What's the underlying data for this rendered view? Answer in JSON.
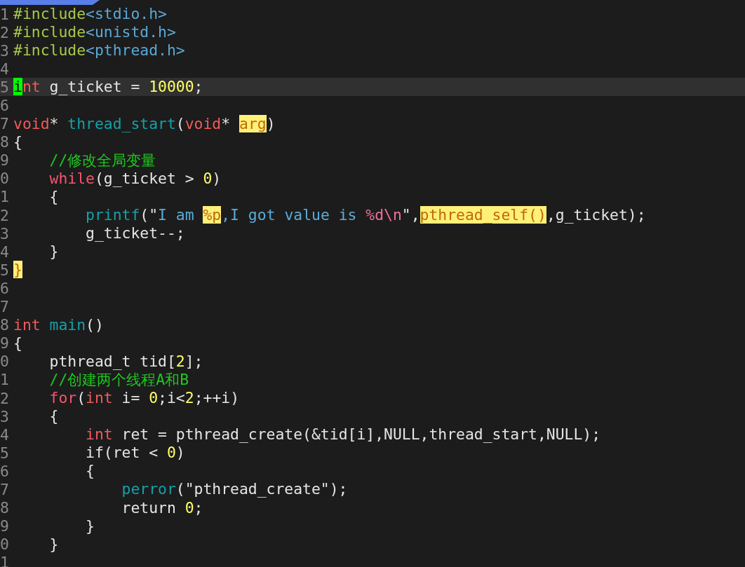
{
  "lines": [
    {
      "number": "1",
      "current": false,
      "tokens": [
        {
          "kind": "preproc",
          "text": "#include"
        },
        {
          "kind": "header",
          "text": "<stdio.h>"
        }
      ]
    },
    {
      "number": "2",
      "current": false,
      "tokens": [
        {
          "kind": "preproc",
          "text": "#include"
        },
        {
          "kind": "header",
          "text": "<unistd.h>"
        }
      ]
    },
    {
      "number": "3",
      "current": false,
      "tokens": [
        {
          "kind": "preproc",
          "text": "#include"
        },
        {
          "kind": "header",
          "text": "<pthread.h>"
        }
      ]
    },
    {
      "number": "4",
      "current": false
    },
    {
      "number": "5",
      "current": true,
      "tokens": [
        {
          "kind": "cursor",
          "text": "i"
        },
        {
          "kind": "keyword",
          "text": "nt"
        },
        {
          "kind": "plain",
          "text": " g_ticket = "
        },
        {
          "kind": "number",
          "text": "10000"
        },
        {
          "kind": "plain",
          "text": ";"
        }
      ]
    },
    {
      "number": "6",
      "current": false
    },
    {
      "number": "7",
      "current": false,
      "tokens": [
        {
          "kind": "keyword",
          "text": "void"
        },
        {
          "kind": "plain",
          "text": "* "
        },
        {
          "kind": "func",
          "text": "thread_start"
        },
        {
          "kind": "plain",
          "text": "("
        },
        {
          "kind": "keyword",
          "text": "void"
        },
        {
          "kind": "plain",
          "text": "* "
        },
        {
          "kind": "match",
          "text": "arg"
        },
        {
          "kind": "plain",
          "text": ")"
        }
      ]
    },
    {
      "number": "8",
      "current": false,
      "tokens": [
        {
          "kind": "plain",
          "text": "{"
        }
      ]
    },
    {
      "number": "9",
      "current": false,
      "tokens": [
        {
          "kind": "comment",
          "text": "    //修改全局变量"
        }
      ]
    },
    {
      "number": "0",
      "current": false,
      "tokens": [
        {
          "kind": "control",
          "text": "    while"
        },
        {
          "kind": "plain",
          "text": "(g_ticket > "
        },
        {
          "kind": "number",
          "text": "0"
        },
        {
          "kind": "plain",
          "text": ")"
        }
      ]
    },
    {
      "number": "1",
      "current": false,
      "tokens": [
        {
          "kind": "plain",
          "text": "    {"
        }
      ]
    },
    {
      "number": "2",
      "current": false,
      "tokens": [
        {
          "kind": "func",
          "text": "        printf"
        },
        {
          "kind": "plain",
          "text": "(\""
        },
        {
          "kind": "string",
          "text": "I am "
        },
        {
          "kind": "match",
          "text": "%p"
        },
        {
          "kind": "string",
          "text": ",I got value is "
        },
        {
          "kind": "format",
          "text": "%d\\n"
        },
        {
          "kind": "plain",
          "text": "\","
        },
        {
          "kind": "match",
          "text": "pthread_self()"
        },
        {
          "kind": "plain",
          "text": ",g_ticket);"
        }
      ]
    },
    {
      "number": "3",
      "current": false,
      "tokens": [
        {
          "kind": "plain",
          "text": "        g_ticket--;"
        }
      ]
    },
    {
      "number": "4",
      "current": false,
      "tokens": [
        {
          "kind": "plain",
          "text": "    }"
        }
      ]
    },
    {
      "number": "5",
      "current": false,
      "tokens": [
        {
          "kind": "match",
          "text": "}"
        }
      ]
    },
    {
      "number": "6",
      "current": false
    },
    {
      "number": "7",
      "current": false
    },
    {
      "number": "8",
      "current": false,
      "tokens": [
        {
          "kind": "keyword",
          "text": "int"
        },
        {
          "kind": "func",
          "text": " main"
        },
        {
          "kind": "plain",
          "text": "()"
        }
      ]
    },
    {
      "number": "9",
      "current": false,
      "tokens": [
        {
          "kind": "plain",
          "text": "{"
        }
      ]
    },
    {
      "number": "0",
      "current": false,
      "tokens": [
        {
          "kind": "plain",
          "text": "    pthread_t tid["
        },
        {
          "kind": "number",
          "text": "2"
        },
        {
          "kind": "plain",
          "text": "];"
        }
      ]
    },
    {
      "number": "1",
      "current": false,
      "tokens": [
        {
          "kind": "comment",
          "text": "    //创建两个线程A和B"
        }
      ]
    },
    {
      "number": "2",
      "current": false,
      "tokens": [
        {
          "kind": "control",
          "text": "    for"
        },
        {
          "kind": "plain",
          "text": "("
        },
        {
          "kind": "keyword",
          "text": "int"
        },
        {
          "kind": "plain",
          "text": " i= "
        },
        {
          "kind": "number",
          "text": "0"
        },
        {
          "kind": "plain",
          "text": ";i<"
        },
        {
          "kind": "number",
          "text": "2"
        },
        {
          "kind": "plain",
          "text": ";++i)"
        }
      ]
    },
    {
      "number": "3",
      "current": false,
      "tokens": [
        {
          "kind": "plain",
          "text": "    {"
        }
      ]
    },
    {
      "number": "4",
      "current": false,
      "tokens": [
        {
          "kind": "keyword",
          "text": "        int"
        },
        {
          "kind": "plain",
          "text": " ret = pthread_create(&tid[i],NULL,thread_start,NULL);"
        }
      ]
    },
    {
      "number": "5",
      "current": false,
      "tokens": [
        {
          "kind": "plain",
          "text": "        if(ret < "
        },
        {
          "kind": "number",
          "text": "0"
        },
        {
          "kind": "plain",
          "text": ")"
        }
      ]
    },
    {
      "number": "6",
      "current": false,
      "tokens": [
        {
          "kind": "plain",
          "text": "        {"
        }
      ]
    },
    {
      "number": "7",
      "current": false,
      "tokens": [
        {
          "kind": "func",
          "text": "            perror"
        },
        {
          "kind": "plain",
          "text": "(\"pthread_create\");"
        }
      ]
    },
    {
      "number": "8",
      "current": false,
      "tokens": [
        {
          "kind": "plain",
          "text": "            return "
        },
        {
          "kind": "number",
          "text": "0"
        },
        {
          "kind": "plain",
          "text": ";"
        }
      ]
    },
    {
      "number": "9",
      "current": false,
      "tokens": [
        {
          "kind": "plain",
          "text": "        }"
        }
      ]
    },
    {
      "number": "0",
      "current": false,
      "tokens": [
        {
          "kind": "plain",
          "text": "    }"
        }
      ]
    },
    {
      "number": "1",
      "current": false
    }
  ]
}
